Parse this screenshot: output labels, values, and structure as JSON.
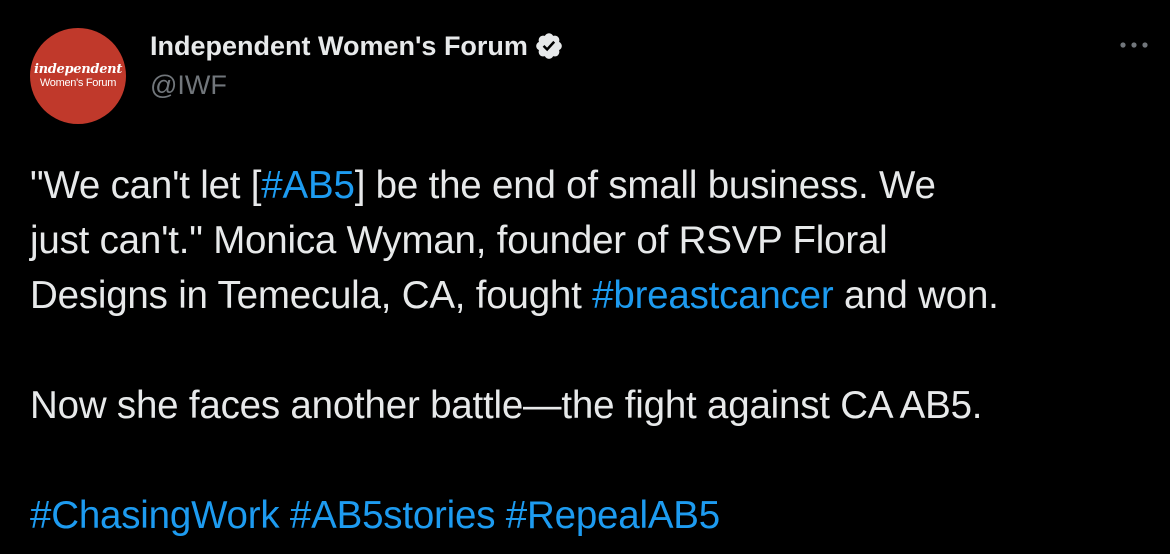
{
  "author": {
    "avatar_line1": "independent",
    "avatar_line2": "Women's Forum",
    "display_name": "Independent Women's Forum",
    "handle": "@IWF"
  },
  "icons": {
    "verified": "verified-badge-icon",
    "more": "more-options-icon"
  },
  "tweet": {
    "line1_pre": "\"We can't let [",
    "line1_tag": "#AB5",
    "line1_post": "] be the end of small business. We",
    "line2": "just can't.\" Monica Wyman, founder of RSVP Floral",
    "line3_pre": "Designs in Temecula, CA, fought ",
    "line3_tag": "#breastcancer",
    "line3_post": " and won.",
    "line4": "Now she faces another battle—the fight against CA AB5.",
    "hashtags": [
      "#ChasingWork",
      "#AB5stories",
      "#RepealAB5"
    ]
  },
  "colors": {
    "background": "#000000",
    "text": "#e7e9ea",
    "secondary": "#71767b",
    "link": "#1d9bf0",
    "avatar": "#c0392b"
  }
}
